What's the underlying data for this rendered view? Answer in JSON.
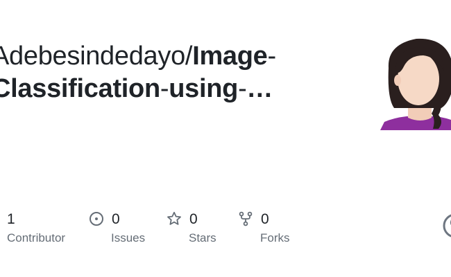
{
  "repo": {
    "owner": "Adebesindedayo/",
    "name_part1": "Image",
    "dash": "-",
    "name_part2": "Classification",
    "name_part3": "using",
    "ellipsis": "…"
  },
  "stats": [
    {
      "count": "1",
      "label": "Contributor",
      "icon": "contributors-icon"
    },
    {
      "count": "0",
      "label": "Issues",
      "icon": "issue-icon"
    },
    {
      "count": "0",
      "label": "Stars",
      "icon": "star-icon"
    },
    {
      "count": "0",
      "label": "Forks",
      "icon": "fork-icon"
    }
  ],
  "colors": {
    "text": "#1f2328",
    "muted": "#656d76",
    "avatar_hair": "#2a1f1e",
    "avatar_skin": "#f6d9c6",
    "avatar_shirt": "#8e2f9e",
    "logo": "#6e7681"
  }
}
